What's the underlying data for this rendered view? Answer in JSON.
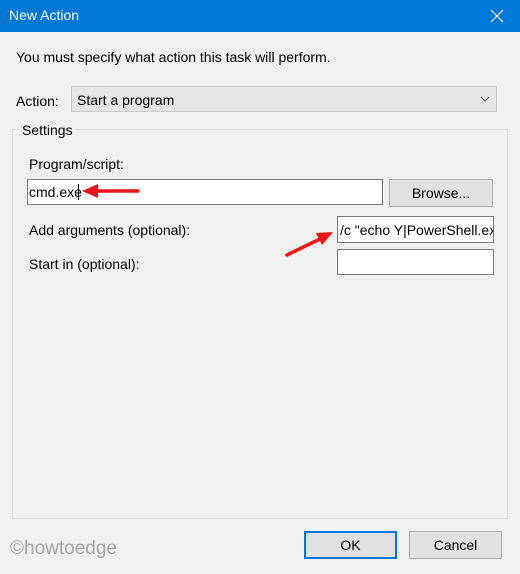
{
  "window": {
    "title": "New Action",
    "close_icon": "close-icon"
  },
  "instruction": "You must specify what action this task will perform.",
  "action": {
    "label": "Action:",
    "selected": "Start a program"
  },
  "settings": {
    "legend": "Settings",
    "program_label": "Program/script:",
    "program_value": "cmd.exe",
    "browse_label": "Browse...",
    "arguments_label": "Add arguments (optional):",
    "arguments_value": "/c \"echo Y|PowerShell.exe",
    "start_in_label": "Start in (optional):",
    "start_in_value": ""
  },
  "buttons": {
    "ok": "OK",
    "cancel": "Cancel"
  },
  "watermark": "©howtoedge",
  "colors": {
    "titlebar": "#0078d7",
    "annotation_arrow": "#e8151b"
  }
}
